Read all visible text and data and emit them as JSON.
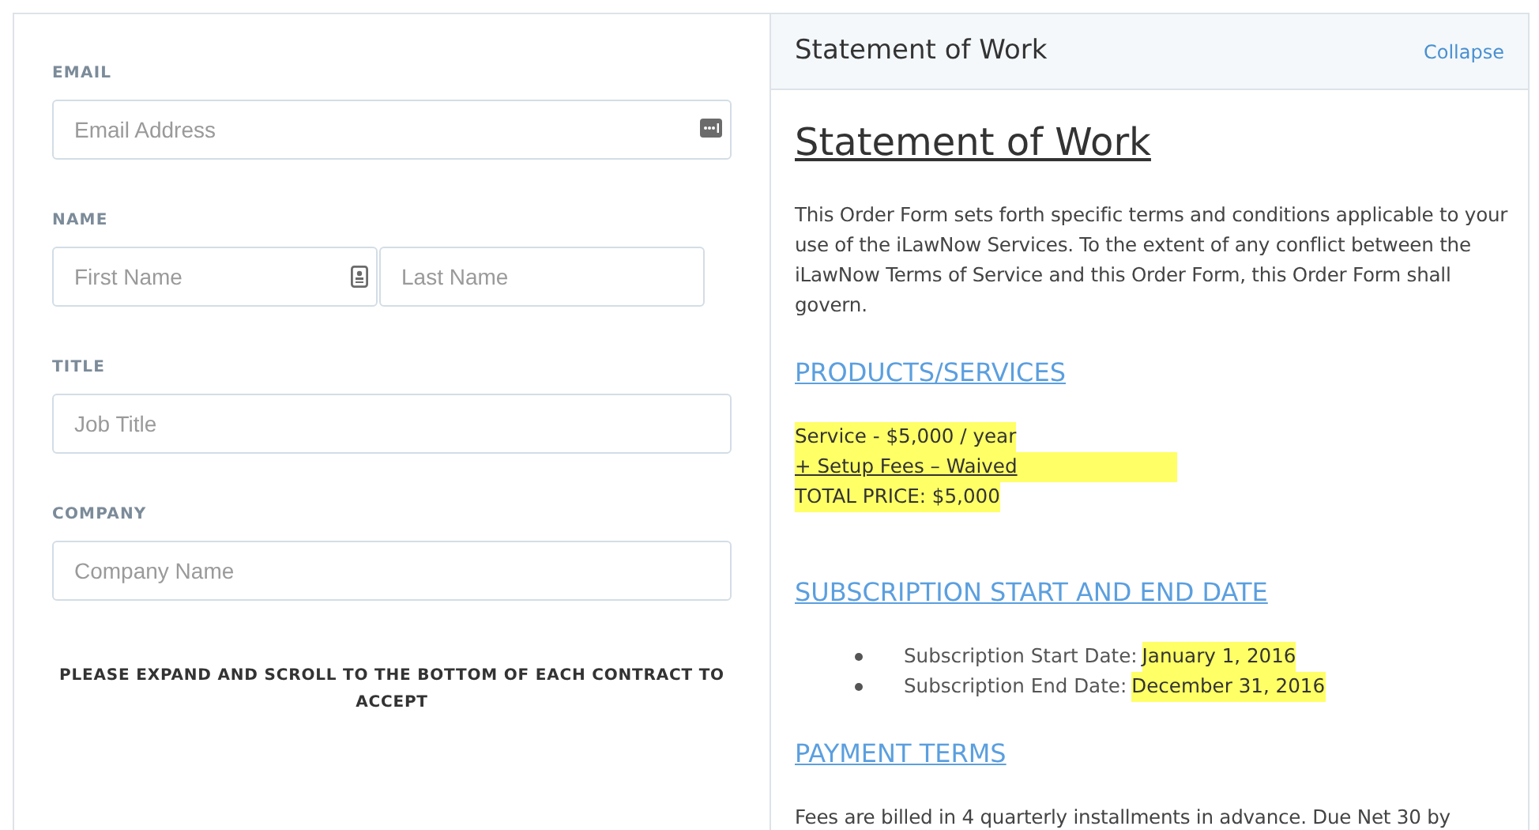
{
  "form": {
    "fields": [
      {
        "label": "EMAIL",
        "inputs": [
          {
            "placeholder": "Email Address",
            "kind": "key"
          }
        ]
      },
      {
        "label": "NAME",
        "inputs": [
          {
            "placeholder": "First Name",
            "kind": "contact"
          },
          {
            "placeholder": "Last Name",
            "kind": "plain"
          }
        ]
      },
      {
        "label": "TITLE",
        "inputs": [
          {
            "placeholder": "Job Title",
            "kind": "plain"
          }
        ]
      },
      {
        "label": "COMPANY",
        "inputs": [
          {
            "placeholder": "Company Name",
            "kind": "plain"
          }
        ]
      }
    ],
    "notice": "PLEASE EXPAND AND SCROLL TO THE BOTTOM OF EACH CONTRACT TO ACCEPT"
  },
  "contract": {
    "header_title": "Statement of Work",
    "collapse_link": "Collapse",
    "title": "Statement of Work",
    "blocks": [
      {
        "kind": "paragraph",
        "text": "This Order Form sets forth specific terms and conditions applicable to your use of the iLawNow Services. To the extent of any conflict between the iLawNow Terms of Service and this Order Form, this Order Form shall govern."
      },
      {
        "kind": "heading",
        "text": "PRODUCTS/SERVICES"
      },
      {
        "kind": "price_lines",
        "lines": [
          {
            "text": "Service - $5,000 / year",
            "highlighted": true,
            "underlined": false
          },
          {
            "text": "+ Setup Fees – Waived",
            "highlighted": true,
            "underlined": true
          },
          {
            "text": "TOTAL PRICE: $5,000",
            "highlighted": true,
            "underlined": false
          }
        ]
      },
      {
        "kind": "heading",
        "text": "SUBSCRIPTION START AND END DATE"
      },
      {
        "kind": "bullets",
        "items": [
          {
            "label": "Subscription Start Date:",
            "value": "January 1, 2016"
          },
          {
            "label": "Subscription End Date:",
            "value": "December 31, 2016"
          }
        ]
      },
      {
        "kind": "heading",
        "text": "PAYMENT TERMS"
      },
      {
        "kind": "paragraph",
        "text": "Fees are billed in 4 quarterly installments in advance. Due Net 30 by"
      }
    ]
  }
}
